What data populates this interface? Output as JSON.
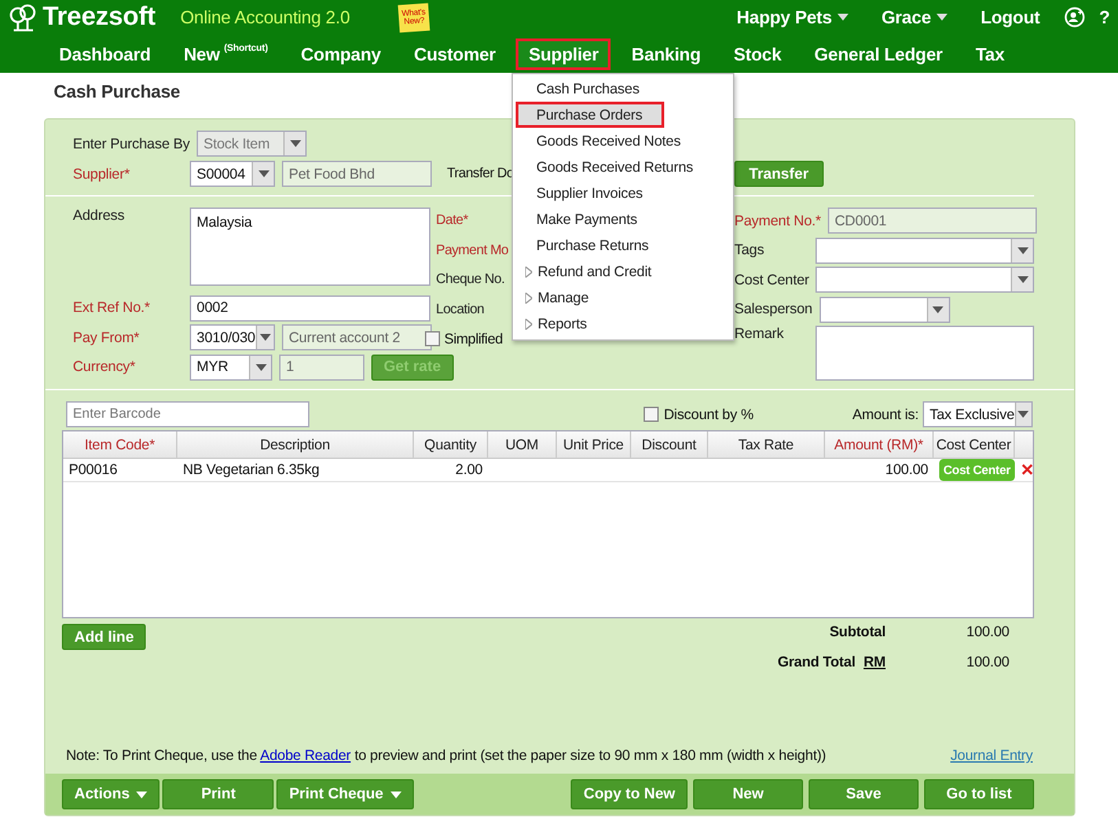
{
  "header": {
    "logo": "Treezsoft",
    "tagline": "Online Accounting 2.0",
    "sticky_note": "What's New?",
    "top_links": [
      {
        "label": "Happy Pets",
        "dropdown": true
      },
      {
        "label": "Grace",
        "dropdown": true
      },
      {
        "label": "Logout",
        "dropdown": false
      }
    ],
    "help": "?"
  },
  "nav": [
    {
      "label": "Dashboard",
      "selected": false
    },
    {
      "label": "New",
      "note": "(Shortcut)",
      "selected": false
    },
    {
      "label": "Company",
      "selected": false
    },
    {
      "label": "Customer",
      "selected": false
    },
    {
      "label": "Supplier",
      "selected": true
    },
    {
      "label": "Banking",
      "selected": false
    },
    {
      "label": "Stock",
      "selected": false
    },
    {
      "label": "General Ledger",
      "selected": false
    },
    {
      "label": "Tax",
      "selected": false
    }
  ],
  "menu": [
    {
      "label": "Cash Purchases",
      "kind": "item",
      "selected": false
    },
    {
      "label": "Purchase Orders",
      "kind": "item",
      "selected": true
    },
    {
      "label": "Goods Received Notes",
      "kind": "item",
      "selected": false
    },
    {
      "label": "Goods Received Returns",
      "kind": "item",
      "selected": false
    },
    {
      "label": "Supplier Invoices",
      "kind": "item",
      "selected": false
    },
    {
      "label": "Make Payments",
      "kind": "item",
      "selected": false
    },
    {
      "label": "Purchase Returns",
      "kind": "item",
      "selected": false
    },
    {
      "label": "Refund and Credit",
      "kind": "submenu",
      "selected": false
    },
    {
      "label": "Manage",
      "kind": "submenu",
      "selected": false
    },
    {
      "label": "Reports",
      "kind": "submenu",
      "selected": false
    }
  ],
  "page_title": "Cash Purchase",
  "top_form": {
    "enter_by": {
      "label": "Enter Purchase By",
      "value": "Stock Item"
    },
    "supplier": {
      "label": "Supplier*",
      "required": true,
      "code": "S00004",
      "name": "Pet Food Bhd"
    },
    "transfer_label": "Transfer Do",
    "transfer_button": "Transfer"
  },
  "col1": {
    "address": {
      "label": "Address",
      "value": "Malaysia"
    },
    "ext_ref": {
      "label": "Ext Ref No.*",
      "required": true,
      "value": "0002"
    },
    "pay_from": {
      "label": "Pay From*",
      "required": true,
      "code": "3010/030",
      "name": "Current account 2"
    },
    "currency": {
      "label": "Currency*",
      "required": true,
      "code": "MYR",
      "rate": "1",
      "button": "Get rate"
    }
  },
  "col2": {
    "labels": [
      {
        "text": "Date*",
        "required": true
      },
      {
        "text": "Payment Mo",
        "required": true
      },
      {
        "text": "Cheque No.",
        "required": false
      },
      {
        "text": "Location",
        "required": false
      }
    ],
    "checks": [
      {
        "label": "Simplified",
        "checked": false
      }
    ]
  },
  "col3": {
    "payment_no": {
      "label": "Payment No.*",
      "required": true,
      "value": "CD0001"
    },
    "selects": [
      {
        "label": "Tags",
        "narrow": false
      },
      {
        "label": "Cost Center",
        "narrow": false
      },
      {
        "label": "Salesperson",
        "narrow": true
      }
    ],
    "remark": {
      "label": "Remark"
    }
  },
  "barcode": {
    "placeholder": "Enter Barcode"
  },
  "discount_by_percent": {
    "label": "Discount by %",
    "checked": false
  },
  "amount_is": {
    "label": "Amount is:",
    "value": "Tax Exclusive"
  },
  "table": {
    "columns": [
      {
        "label": "Item Code*",
        "required": true
      },
      {
        "label": "Description",
        "required": false
      },
      {
        "label": "Quantity",
        "required": false
      },
      {
        "label": "UOM",
        "required": false
      },
      {
        "label": "Unit Price",
        "required": false
      },
      {
        "label": "Discount",
        "required": false
      },
      {
        "label": "Tax Rate",
        "required": false
      },
      {
        "label": "Amount (RM)*",
        "required": true
      },
      {
        "label": "Cost Center",
        "required": false
      }
    ],
    "rows": [
      {
        "item_code": "P00016",
        "description": "NB Vegetarian 6.35kg",
        "quantity": "2.00",
        "amount": "100.00",
        "cost_center_button": "Cost Center",
        "delete": "✕"
      }
    ]
  },
  "add_line": "Add line",
  "totals": {
    "subtotal_label": "Subtotal",
    "subtotal": "100.00",
    "grand_total_label": "Grand Total",
    "currency": "RM",
    "grand_total": "100.00"
  },
  "note": {
    "before": "Note: To Print Cheque, use the",
    "link": "Adobe Reader",
    "after": "to preview and print (set the paper size to 90 mm x 180 mm (width x height))"
  },
  "journal_entry": "Journal Entry",
  "footer_left": [
    {
      "label": "Actions",
      "dropdown": true
    },
    {
      "label": "Print",
      "dropdown": false
    },
    {
      "label": "Print Cheque",
      "dropdown": true
    }
  ],
  "footer_right": [
    "Copy to New",
    "New",
    "Save",
    "Go to list"
  ]
}
